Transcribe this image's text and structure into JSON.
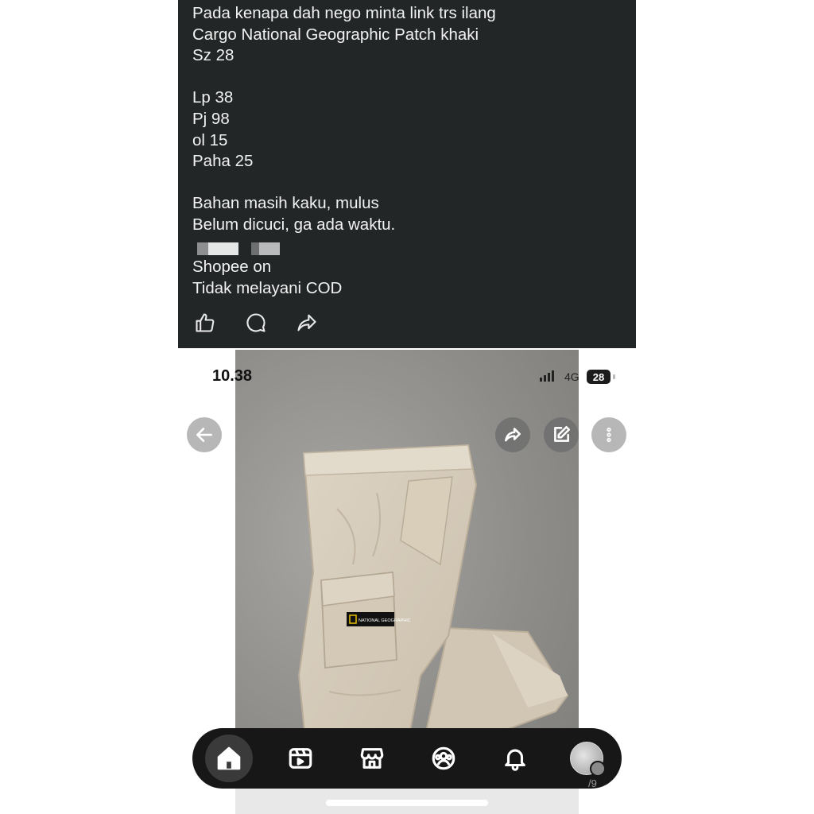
{
  "post": {
    "lines": [
      "Pada kenapa dah nego minta link trs ilang",
      "Cargo National Geographic Patch khaki",
      "Sz 28",
      "",
      "Lp 38",
      "Pj 98",
      "ol 15",
      "Paha 25",
      "",
      "Bahan masih kaku, mulus",
      "Belum dicuci, ga ada waktu.",
      "Shopee on",
      "Tidak melayani COD"
    ],
    "actions": {
      "like": "thumbs-up-icon",
      "comment": "comment-bubble-icon",
      "share": "share-arrow-icon"
    }
  },
  "screenshot": {
    "status": {
      "time": "10.38",
      "network": "4G",
      "battery": "28"
    },
    "top_buttons": [
      "back-arrow-icon",
      "share-icon",
      "edit-icon",
      "more-icon"
    ],
    "patch_text": "NATIONAL GEOGRAPHIC",
    "nav": {
      "items": [
        "home-icon",
        "reels-icon",
        "marketplace-icon",
        "groups-icon",
        "notifications-icon",
        "profile-avatar"
      ],
      "active": "home-icon"
    },
    "corner_text": "/9"
  },
  "colors": {
    "post_bg": "#232627",
    "nav_bg": "#171717",
    "pants": "#d8cfbf"
  }
}
